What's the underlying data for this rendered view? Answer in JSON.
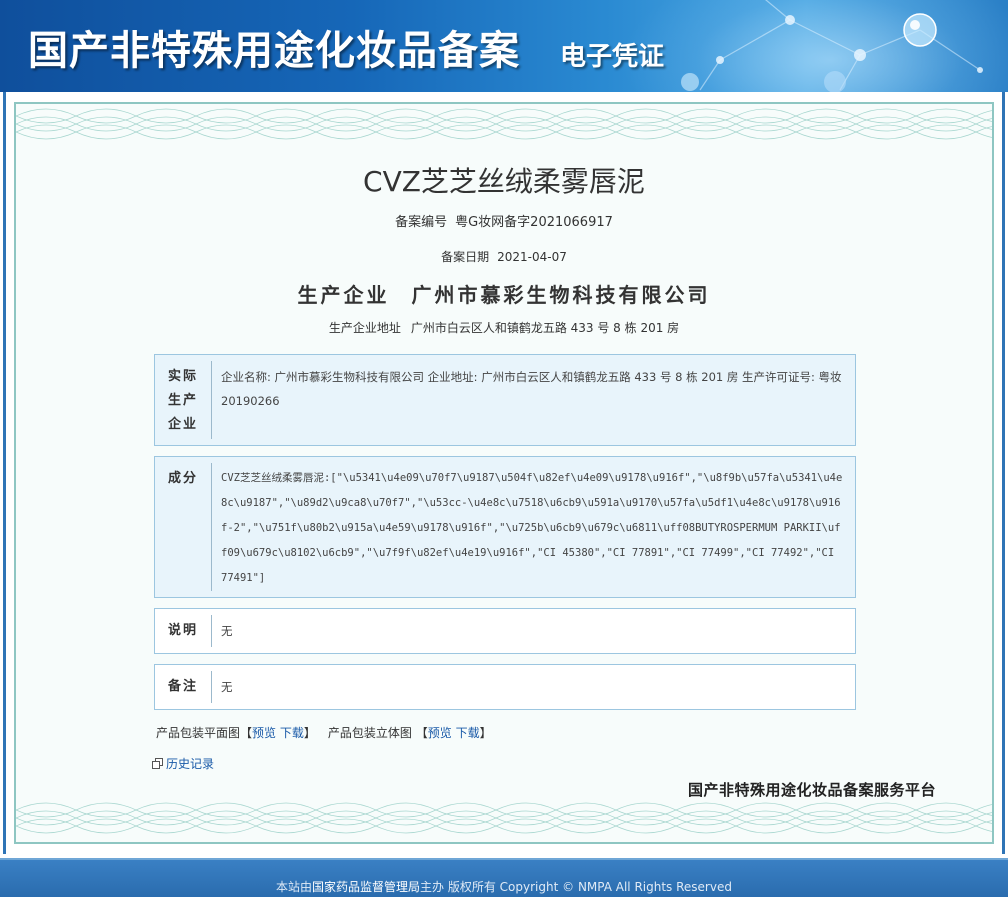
{
  "header": {
    "title": "国产非特殊用途化妆品备案",
    "subtitle": "电子凭证"
  },
  "product": {
    "name": "CVZ芝芝丝绒柔雾唇泥",
    "record_no_label": "备案编号",
    "record_no": "粤G妆网备字2021066917",
    "record_date_label": "备案日期",
    "record_date": "2021-04-07",
    "enterprise_label": "生产企业",
    "enterprise": "广州市慕彩生物科技有限公司",
    "address_label": "生产企业地址",
    "address": "广州市白云区人和镇鹤龙五路 433 号 8 栋 201 房"
  },
  "sections": {
    "producer_label": "实际生产企业",
    "producer_text": "企业名称: 广州市慕彩生物科技有限公司  企业地址: 广州市白云区人和镇鹤龙五路 433 号 8 栋 201 房  生产许可证号: 粤妆20190266",
    "ingredients_label": "成分",
    "ingredients_text": "CVZ芝芝丝绒柔雾唇泥:[\"\\u5341\\u4e09\\u70f7\\u9187\\u504f\\u82ef\\u4e09\\u9178\\u916f\",\"\\u8f9b\\u57fa\\u5341\\u4e8c\\u9187\",\"\\u89d2\\u9ca8\\u70f7\",\"\\u53cc-\\u4e8c\\u7518\\u6cb9\\u591a\\u9170\\u57fa\\u5df1\\u4e8c\\u9178\\u916f-2\",\"\\u751f\\u80b2\\u915a\\u4e59\\u9178\\u916f\",\"\\u725b\\u6cb9\\u679c\\u6811\\uff08BUTYROSPERMUM PARKII\\uff09\\u679c\\u8102\\u6cb9\",\"\\u7f9f\\u82ef\\u4e19\\u916f\",\"CI 45380\",\"CI 77891\",\"CI 77499\",\"CI 77492\",\"CI 77491\"]",
    "note_label": "说明",
    "note_text": "无",
    "remark_label": "备注",
    "remark_text": "无"
  },
  "images": {
    "flat_label": "产品包装平面图",
    "solid_label": "产品包装立体图",
    "bracket_open": "【",
    "bracket_close": "】",
    "preview": "预览",
    "download": "下载"
  },
  "history": "历史记录",
  "platform": "国产非特殊用途化妆品备案服务平台",
  "footer": {
    "pre": "本站由",
    "org": "国家药品监督管理局",
    "post": "主办 版权所有 Copyright © NMPA All Rights Reserved"
  },
  "colors": {
    "banner_blue": "#1667b8",
    "link_blue": "#1a5aa8",
    "box_bg": "#e8f4fb",
    "box_border": "#9cc6e0",
    "cert_border": "#8ec6c2"
  },
  "icons": [
    "history-icon",
    "molecule-decoration"
  ]
}
